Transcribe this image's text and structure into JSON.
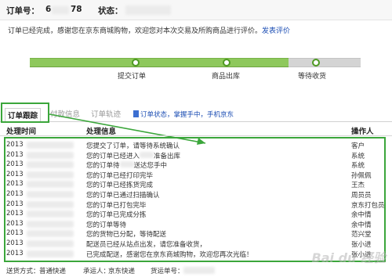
{
  "header": {
    "order_label": "订单号：",
    "order_number_visible_prefix": "6",
    "order_number_visible_suffix": "78",
    "status_label": "状态："
  },
  "notice": {
    "text": "订单已经完成，感谢您在京东商城购物，欢迎您对本次交易及所购商品进行评价。",
    "link": "发表评价"
  },
  "progress": {
    "steps": [
      "提交订单",
      "商品出库",
      "等待收货"
    ],
    "completed_fraction": 0.78
  },
  "tabs": {
    "items": [
      "订单跟踪",
      "付款信息",
      "订单轨迹"
    ],
    "links": [
      "订单状态，掌握手中，手机京东"
    ]
  },
  "table": {
    "headers": [
      "处理时间",
      "处理信息",
      "操作人"
    ],
    "rows": [
      {
        "time": "2013",
        "info": "您提交了订单，请等待系统确认",
        "operator": "客户"
      },
      {
        "time": "2013",
        "info": "您的订单已经进入",
        "info2": "准备出库",
        "operator": "系统"
      },
      {
        "time": "2013",
        "info": "您的订单待",
        "info2": "送达您手中",
        "operator": "系统"
      },
      {
        "time": "2013",
        "info": "您的订单已经打印完毕",
        "operator": "孙佩佩"
      },
      {
        "time": "2013",
        "info": "您的订单已经拣货完成",
        "operator": "王杰"
      },
      {
        "time": "2013",
        "info": "您的订单已通过扫描确认",
        "operator": "周员员"
      },
      {
        "time": "2013",
        "info": "您的订单已打包完毕",
        "operator": "京东打包员"
      },
      {
        "time": "2013",
        "info": "您的订单已完成分拣",
        "operator": "余中情"
      },
      {
        "time": "2013",
        "info": "您的订单等待",
        "operator": "余中情"
      },
      {
        "time": "2013",
        "info": "您的货物已分配，等待配送",
        "operator": "范兴堂"
      },
      {
        "time": "2013",
        "info": "配送员已经从站点出发，请您准备收货，",
        "operator": "张小进"
      },
      {
        "time": "2013",
        "info": "已完成配送，感谢您在京东商城购物，欢迎您再次光临！",
        "operator": "张小进"
      }
    ]
  },
  "footer": {
    "shipping_method_label": "送货方式：",
    "shipping_method": "普通快递",
    "carrier_label": "承运人：",
    "carrier": "京东快递",
    "tracking_label": "货运单号："
  },
  "watermark": "Bai du 经验"
}
